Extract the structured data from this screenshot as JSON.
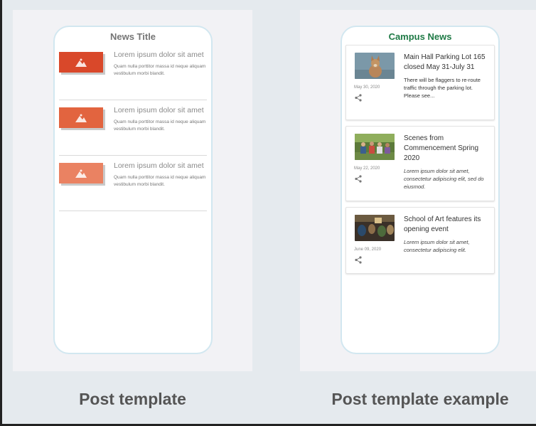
{
  "template": {
    "title": "News Title",
    "items": [
      {
        "color": "#d9482a",
        "heading": "Lorem ipsum dolor sit amet",
        "body": "Quam nulla porttitor massa id neque aliquam vestibulum morbi blandit."
      },
      {
        "color": "#e2643f",
        "heading": "Lorem ipsum dolor sit amet",
        "body": "Quam nulla porttitor massa id neque aliquam vestibulum morbi blandit."
      },
      {
        "color": "#ea8262",
        "heading": "Lorem ipsum dolor sit amet",
        "body": "Quam nulla porttitor massa id neque aliquam vestibulum morbi blandit."
      }
    ],
    "caption": "Post template"
  },
  "example": {
    "title": "Campus News",
    "cards": [
      {
        "heading": "Main Hall Parking Lot 165 closed May 31-July 31",
        "date": "May 30, 2020",
        "body": "There will be flaggers to re-route traffic through the parking lot. Please see...",
        "italic": false,
        "image": "dog photo"
      },
      {
        "heading": "Scenes from Commencement Spring 2020",
        "date": "May 22, 2020",
        "body": "Lorem ipsum dolor sit amet, consectetur adipiscing elit, sed do eiusmod.",
        "italic": true,
        "image": "group photo"
      },
      {
        "heading": "School of Art features its opening event",
        "date": "June 09, 2020",
        "body": "Lorem ipsum dolor sit amet, consectetur adipiscing elit.",
        "italic": true,
        "image": "crowd photo"
      }
    ],
    "caption": "Post template example"
  },
  "colors": {
    "accent_green": "#1f7a46",
    "phone_border": "#d2e7f0"
  },
  "icons": [
    "image-placeholder-icon",
    "share-icon"
  ]
}
